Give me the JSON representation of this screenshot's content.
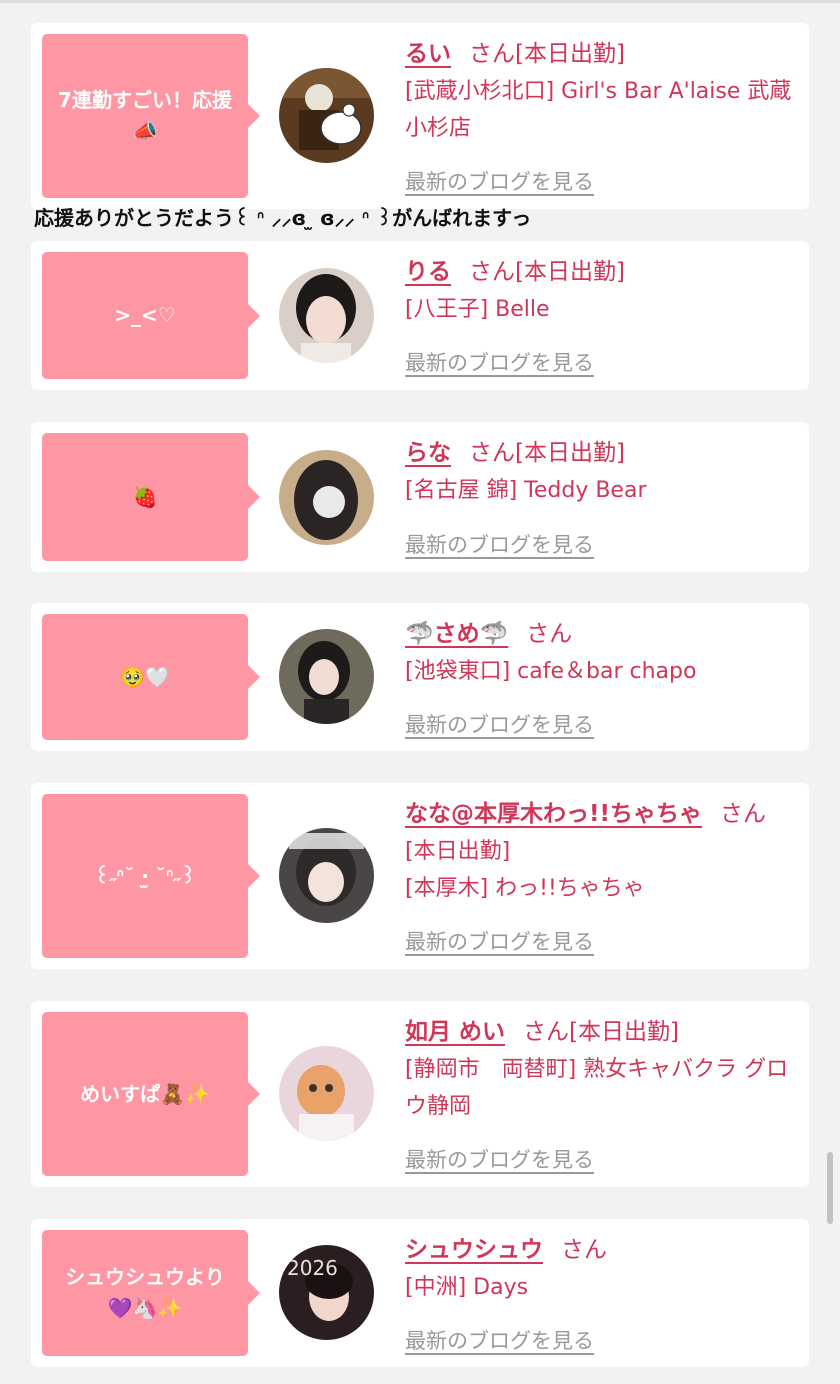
{
  "colors": {
    "accent": "#d03658",
    "bubble": "#ff96a4",
    "link_gray": "#999999"
  },
  "blog_link_label": "最新のブログを見る",
  "cards": [
    {
      "message": "7連勤すごい！応援📣",
      "name": "るい",
      "suffix": "さん",
      "status": "[本日出勤]",
      "shop": "[武蔵小杉北口] Girl's Bar A'laise 武蔵小杉店",
      "reply": "応援ありがとうだよう꒰ ᐢ ⸝⸝ɞ ̫ ɞ⸝⸝ ᐢ ꒱がんばれますっ"
    },
    {
      "message": ">_<♡",
      "name": "りる",
      "suffix": "さん",
      "status": "[本日出勤]",
      "shop": "[八王子] Belle"
    },
    {
      "message": "🍓",
      "name": "らな",
      "suffix": "さん",
      "status": "[本日出勤]",
      "shop": "[名古屋 錦] Teddy Bear"
    },
    {
      "message": "🥹🤍",
      "name": "🦈さめ🦈",
      "suffix": "さん",
      "status": "",
      "shop": "[池袋東口] cafe＆bar chapo"
    },
    {
      "message": "꒰˶ᐢ˘ ·̫ ˘ᐢ˶꒱",
      "name": "なな@本厚木わっ!!ちゃちゃ",
      "suffix": "さん",
      "status": "[本日出勤]",
      "shop": "[本厚木] わっ!!ちゃちゃ"
    },
    {
      "message": "めいすぱ🧸✨",
      "name": "如月 めい",
      "suffix": "さん",
      "status": "[本日出勤]",
      "shop": "[静岡市　両替町] 熟女キャバクラ グロウ静岡"
    },
    {
      "message": "シュウシュウより💜🦄✨",
      "name": "シュウシュウ",
      "suffix": "さん",
      "status": "",
      "shop": "[中洲] Days"
    }
  ]
}
